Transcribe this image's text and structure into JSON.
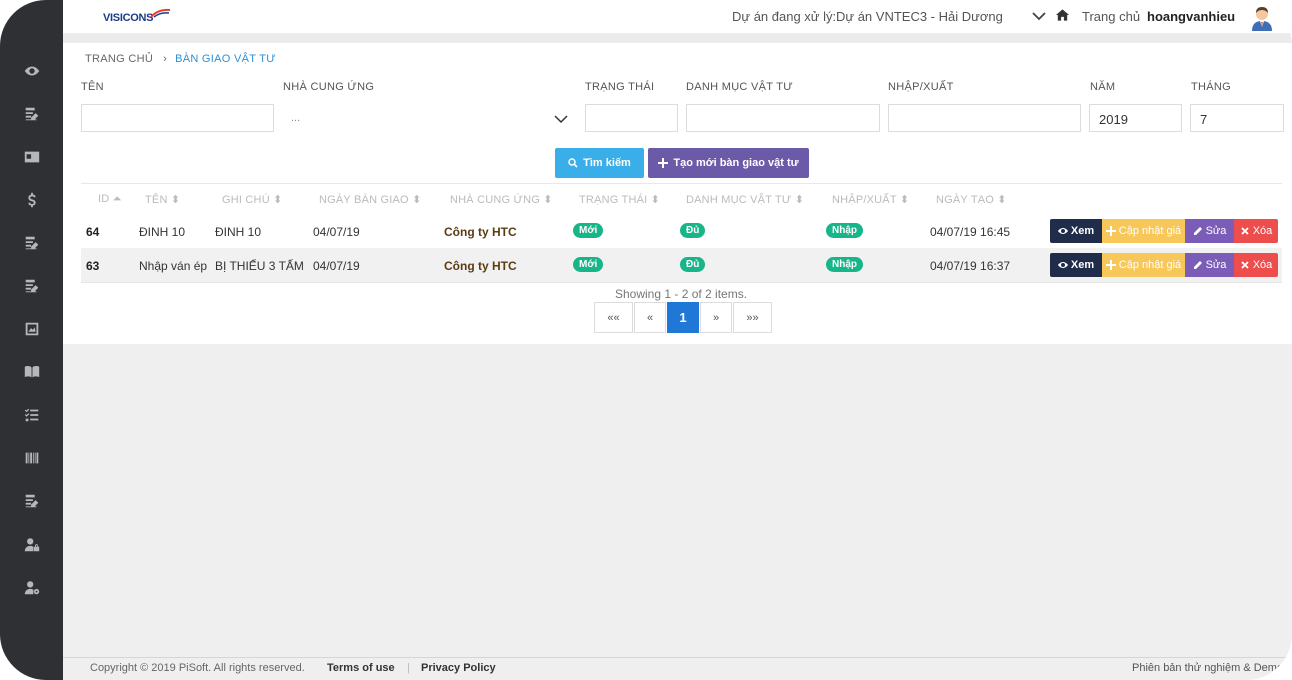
{
  "header": {
    "project_label": "Dự án đang xử lý:",
    "project_value": "Dự án VNTEC3 - Hải Dương",
    "home_label": "Trang chủ",
    "username": "hoangvanhieu",
    "logo_text": "VISICONS"
  },
  "sidebar": {
    "icons": [
      "eye-icon",
      "edit-list-icon",
      "id-card-icon",
      "dollar-icon",
      "edit-list-icon",
      "edit-list-icon",
      "image-frame-icon",
      "book-icon",
      "checklist-icon",
      "barcode-icon",
      "edit-list-icon",
      "user-lock-icon",
      "user-cog-icon"
    ]
  },
  "breadcrumb": {
    "home": "TRANG CHỦ",
    "current": "BÀN GIAO VẬT TƯ"
  },
  "filters": {
    "name_label": "TÊN",
    "supplier_label": "NHÀ CUNG ỨNG",
    "supplier_placeholder": "...",
    "status_label": "TRẠNG THÁI",
    "category_label": "DANH MỤC VẬT TƯ",
    "io_label": "NHẬP/XUẤT",
    "year_label": "NĂM",
    "year_value": "2019",
    "month_label": "THÁNG",
    "month_value": "7"
  },
  "buttons": {
    "search": "Tìm kiếm",
    "create": "Tạo mới bàn giao vật tư"
  },
  "table": {
    "columns": [
      "ID",
      "TÊN",
      "GHI CHÚ",
      "NGÀY BÀN GIAO",
      "NHÀ CUNG ỨNG",
      "TRẠNG THÁI",
      "DANH MỤC VẬT TƯ",
      "NHẬP/XUẤT",
      "NGÀY TẠO"
    ],
    "rows": [
      {
        "id": "64",
        "name": "ĐINH 10",
        "note": "ĐINH 10",
        "handover_date": "04/07/19",
        "supplier": "Công ty HTC",
        "status": "Mới",
        "category": "Đủ",
        "io": "Nhập",
        "created": "04/07/19 16:45"
      },
      {
        "id": "63",
        "name": "Nhập ván ép",
        "note": "BỊ THIẾU 3 TẤM",
        "handover_date": "04/07/19",
        "supplier": "Công ty HTC",
        "status": "Mới",
        "category": "Đủ",
        "io": "Nhập",
        "created": "04/07/19 16:37"
      }
    ],
    "actions": {
      "view": "Xem",
      "update_price": "Cập nhật giá",
      "edit": "Sửa",
      "delete": "Xóa"
    }
  },
  "pagination": {
    "summary": "Showing 1 - 2 of 2 items.",
    "first": "««",
    "prev": "«",
    "current": "1",
    "next": "»",
    "last": "»»"
  },
  "footer": {
    "copyright": "Copyright © 2019 PiSoft. All rights reserved.",
    "terms": "Terms of use",
    "separator": "|",
    "privacy": "Privacy Policy",
    "version": "Phiên bản thử nghiệm & Demo"
  },
  "colors": {
    "sidebar": "#2f3033",
    "search_button": "#3aaee8",
    "create_button": "#6b5aa8",
    "badge_green": "#17b58a",
    "view_button": "#1f2d4a",
    "price_button": "#f7c75a",
    "edit_button": "#7b5cb8",
    "delete_button": "#ee4d4d",
    "active_page": "#1f78d6"
  }
}
